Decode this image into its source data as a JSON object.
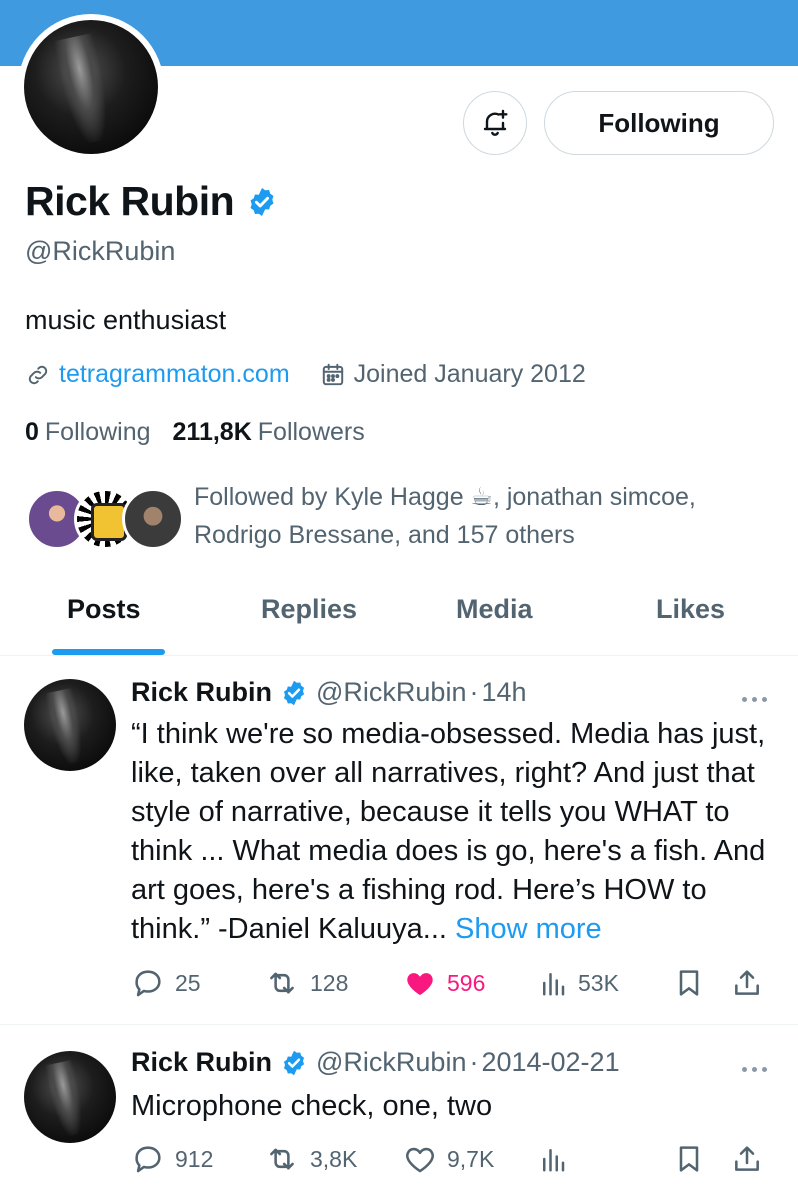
{
  "profile": {
    "display_name": "Rick Rubin",
    "handle": "@RickRubin",
    "bio": "music enthusiast",
    "website": "tetragrammaton.com",
    "joined": "Joined January 2012",
    "following_count": "0",
    "following_label": "Following",
    "followers_count": "211,8K",
    "followers_label": "Followers",
    "follow_button_label": "Following",
    "followed_by_text": "Followed by Kyle Hagge ☕, jonathan simcoe, Rodrigo Bressane, and 157 others"
  },
  "tabs": [
    {
      "label": "Posts",
      "active": true
    },
    {
      "label": "Replies",
      "active": false
    },
    {
      "label": "Media",
      "active": false
    },
    {
      "label": "Likes",
      "active": false
    }
  ],
  "tweets": [
    {
      "name": "Rick Rubin",
      "handle": "@RickRubin",
      "dot": "·",
      "time": "14h",
      "text": "“I think we're so media-obsessed. Media has just, like, taken over all narratives, right? And just that style of narrative, because it tells you WHAT to think ... What media does is go, here's a fish. And art goes, here's a fishing rod. Here’s HOW to think.” -Daniel Kaluuya...",
      "show_more": "Show more",
      "replies": "25",
      "reposts": "128",
      "likes": "596",
      "views": "53K",
      "liked": true
    },
    {
      "name": "Rick Rubin",
      "handle": "@RickRubin",
      "dot": "·",
      "time": "2014-02-21",
      "text": "Microphone check, one, two",
      "replies": "912",
      "reposts": "3,8K",
      "likes": "9,7K",
      "views": "",
      "liked": false
    }
  ],
  "colors": {
    "banner": "#3f9ae0",
    "accent": "#1d9bf0",
    "like": "#f91880",
    "secondary_text": "#536471"
  },
  "icons": [
    "bell-plus-icon",
    "verified-badge-icon",
    "link-icon",
    "calendar-icon",
    "reply-icon",
    "repost-icon",
    "heart-icon",
    "views-icon",
    "bookmark-icon",
    "share-icon",
    "more-icon"
  ]
}
